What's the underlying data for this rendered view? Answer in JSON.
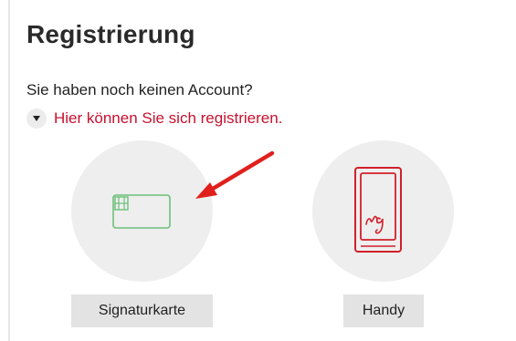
{
  "registration": {
    "title": "Registrierung",
    "question": "Sie haben noch keinen Account?",
    "register_link": "Hier können Sie sich registrieren."
  },
  "options": {
    "card_label": "Signaturkarte",
    "phone_label": "Handy"
  },
  "colors": {
    "accent_red": "#c8102e",
    "card_icon_green": "#6cc07a",
    "phone_icon_red": "#d21f2b",
    "circle_bg": "#eeeeee",
    "button_bg": "#e3e3e3"
  },
  "icons": {
    "expand": "caret-down-icon",
    "card": "signature-card-icon",
    "phone": "mobile-signature-icon",
    "pointer": "red-arrow-annotation"
  }
}
